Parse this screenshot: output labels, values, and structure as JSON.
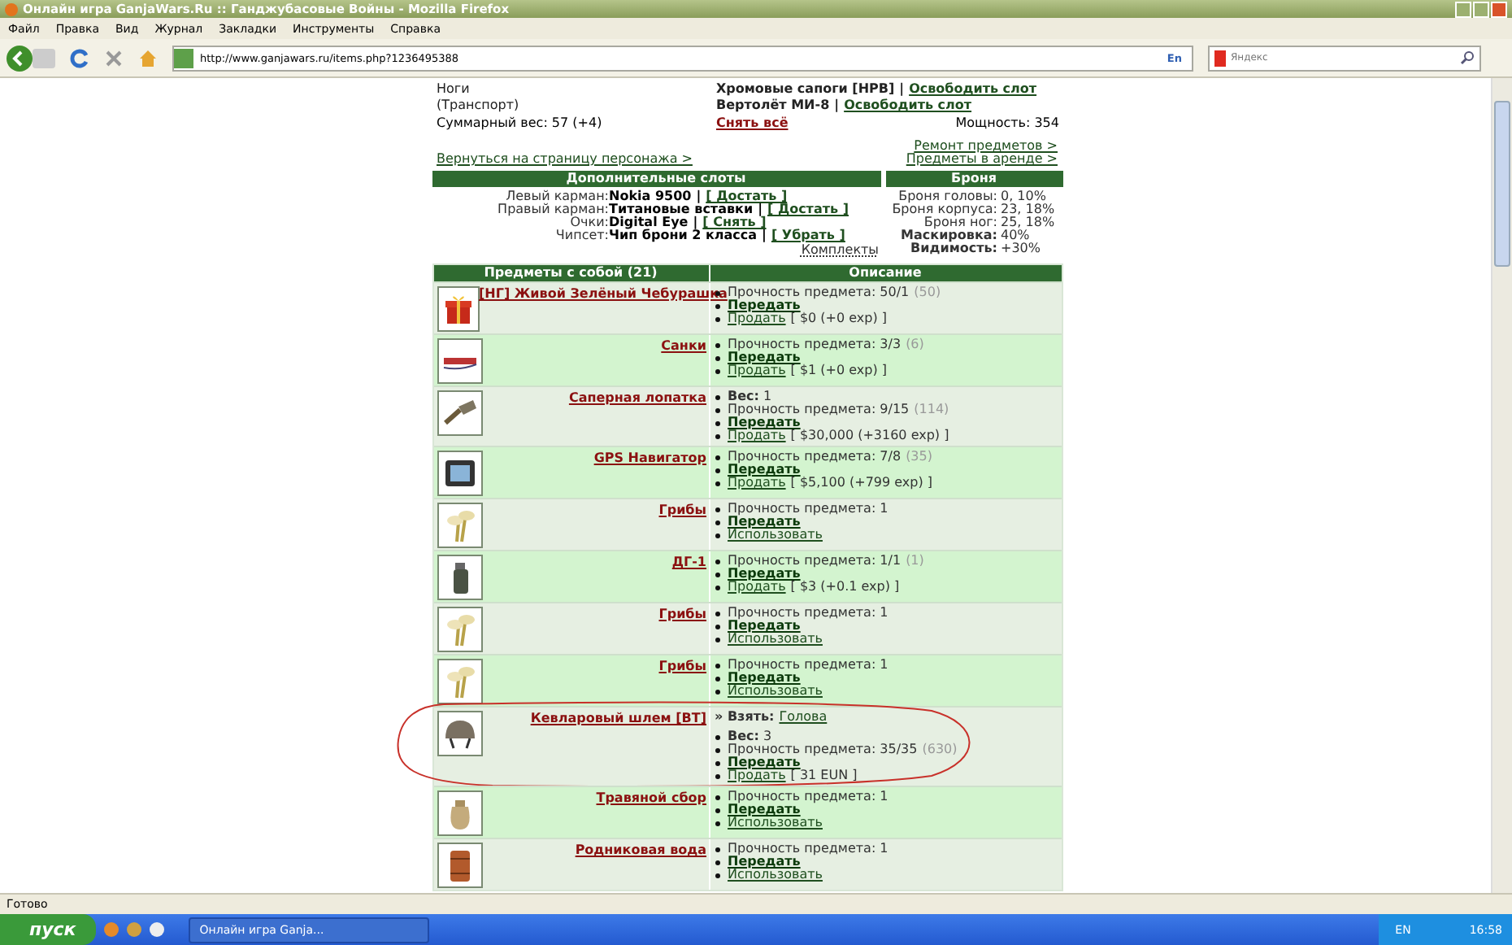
{
  "window": {
    "title": "Онлайн игра GanjaWars.Ru :: Ганджубасовые Войны - Mozilla Firefox"
  },
  "menu": [
    "Файл",
    "Правка",
    "Вид",
    "Журнал",
    "Закладки",
    "Инструменты",
    "Справка"
  ],
  "address_bar": {
    "url": "http://www.ganjawars.ru/items.php?1236495388",
    "language": "En"
  },
  "search": {
    "placeholder": "Яндекс"
  },
  "equipment": [
    {
      "slot": "Ноги",
      "item": "Хромовые сапоги [HPB]",
      "separator": "|",
      "action": "Освободить слот"
    },
    {
      "slot": "(Транспорт)",
      "item": "Вертолёт МИ-8",
      "separator": "|",
      "action": "Освободить слот"
    }
  ],
  "summary": {
    "weight": "Суммарный вес: 57 (+4)",
    "remove_all": "Снять всё",
    "power": "Мощность: 354"
  },
  "links": {
    "back": "Вернуться на страницу персонажа >",
    "repair": "Ремонт предметов >",
    "rented": "Предметы в аренде >"
  },
  "extra_slots": {
    "title": "Дополнительные слоты",
    "rows": [
      {
        "label": "Левый карман:",
        "item": "Nokia 9500",
        "separator": "|",
        "action": "[ Достать ]"
      },
      {
        "label": "Правый карман:",
        "item": "Титановые вставки",
        "separator": "|",
        "action": "[ Достать ]"
      },
      {
        "label": "Очки:",
        "item": "Digital Eye",
        "separator": "|",
        "action": "[ Снять ]"
      },
      {
        "label": "Чипсет:",
        "item": "Чип брони 2 класса",
        "separator": "|",
        "action": "[ Убрать ]"
      }
    ],
    "sets_link": "Комплекты"
  },
  "armor": {
    "title": "Броня",
    "rows": [
      {
        "label": "Броня головы:",
        "value": "0, 10%",
        "emphasis": false
      },
      {
        "label": "Броня корпуса:",
        "value": "23, 18%",
        "emphasis": false
      },
      {
        "label": "Броня ног:",
        "value": "25, 18%",
        "emphasis": false
      },
      {
        "label": "Маскировка:",
        "value": "40%",
        "emphasis": true
      },
      {
        "label": "Видимость:",
        "value": "+30%",
        "emphasis": true
      }
    ]
  },
  "items_table": {
    "columns": [
      "Предметы с собой (21)",
      "Описание"
    ],
    "rows": [
      {
        "name": "[НГ] Живой Зелёный Чебурашка",
        "kind": "gift",
        "lines": [
          {
            "kind": "durability",
            "text": "Прочность предмета: 50/1",
            "extra": "(50)"
          },
          {
            "kind": "transfer",
            "text": "Передать"
          },
          {
            "kind": "sell",
            "text": "Продать",
            "extra": "[ $0 (+0 exp) ]"
          }
        ]
      },
      {
        "name": "Санки",
        "kind": "sled",
        "lines": [
          {
            "kind": "durability",
            "text": "Прочность предмета: 3/3",
            "extra": "(6)"
          },
          {
            "kind": "transfer",
            "text": "Передать"
          },
          {
            "kind": "sell",
            "text": "Продать",
            "extra": "[ $1 (+0 exp) ]"
          }
        ]
      },
      {
        "name": "Саперная лопатка",
        "kind": "shovel",
        "lines": [
          {
            "kind": "weight",
            "text": "Вес:",
            "extra": "1"
          },
          {
            "kind": "durability",
            "text": "Прочность предмета: 9/15",
            "extra": "(114)"
          },
          {
            "kind": "transfer",
            "text": "Передать"
          },
          {
            "kind": "sell",
            "text": "Продать",
            "extra": "[ $30,000 (+3160 exp) ]"
          }
        ]
      },
      {
        "name": "GPS Навигатор",
        "kind": "gps",
        "lines": [
          {
            "kind": "durability",
            "text": "Прочность предмета: 7/8",
            "extra": "(35)"
          },
          {
            "kind": "transfer",
            "text": "Передать"
          },
          {
            "kind": "sell",
            "text": "Продать",
            "extra": "[ $5,100 (+799 exp) ]"
          }
        ]
      },
      {
        "name": "Грибы",
        "kind": "mushroom",
        "lines": [
          {
            "kind": "durability",
            "text": "Прочность предмета: 1"
          },
          {
            "kind": "transfer",
            "text": "Передать"
          },
          {
            "kind": "use",
            "text": "Использовать"
          }
        ]
      },
      {
        "name": "ДГ-1",
        "kind": "grenade",
        "lines": [
          {
            "kind": "durability",
            "text": "Прочность предмета: 1/1",
            "extra": "(1)"
          },
          {
            "kind": "transfer",
            "text": "Передать"
          },
          {
            "kind": "sell",
            "text": "Продать",
            "extra": "[ $3 (+0.1 exp) ]"
          }
        ]
      },
      {
        "name": "Грибы",
        "kind": "mushroom",
        "lines": [
          {
            "kind": "durability",
            "text": "Прочность предмета: 1"
          },
          {
            "kind": "transfer",
            "text": "Передать"
          },
          {
            "kind": "use",
            "text": "Использовать"
          }
        ]
      },
      {
        "name": "Грибы",
        "kind": "mushroom",
        "lines": [
          {
            "kind": "durability",
            "text": "Прочность предмета: 1"
          },
          {
            "kind": "transfer",
            "text": "Передать"
          },
          {
            "kind": "use",
            "text": "Использовать"
          }
        ]
      },
      {
        "name": "Кевларовый шлем [ВТ]",
        "kind": "helmet",
        "lines": [
          {
            "kind": "take",
            "text": "» Взять:",
            "extra": "Голова"
          },
          {
            "kind": "weight",
            "text": "Вес:",
            "extra": "3"
          },
          {
            "kind": "durability",
            "text": "Прочность предмета: 35/35",
            "extra": "(630)"
          },
          {
            "kind": "transfer",
            "text": "Передать"
          },
          {
            "kind": "sell",
            "text": "Продать",
            "extra": "[ 31 EUN ]"
          }
        ]
      },
      {
        "name": "Травяной сбор",
        "kind": "bag",
        "lines": [
          {
            "kind": "durability",
            "text": "Прочность предмета: 1"
          },
          {
            "kind": "transfer",
            "text": "Передать"
          },
          {
            "kind": "use",
            "text": "Использовать"
          }
        ]
      },
      {
        "name": "Родниковая вода",
        "kind": "barrel",
        "lines": [
          {
            "kind": "durability",
            "text": "Прочность предмета: 1"
          },
          {
            "kind": "transfer",
            "text": "Передать"
          },
          {
            "kind": "use",
            "text": "Использовать"
          }
        ]
      }
    ]
  },
  "status_bar": {
    "text": "Готово"
  },
  "taskbar": {
    "start": "пуск",
    "task": "Онлайн игра Ganja...",
    "language": "EN",
    "clock": "16:58"
  }
}
